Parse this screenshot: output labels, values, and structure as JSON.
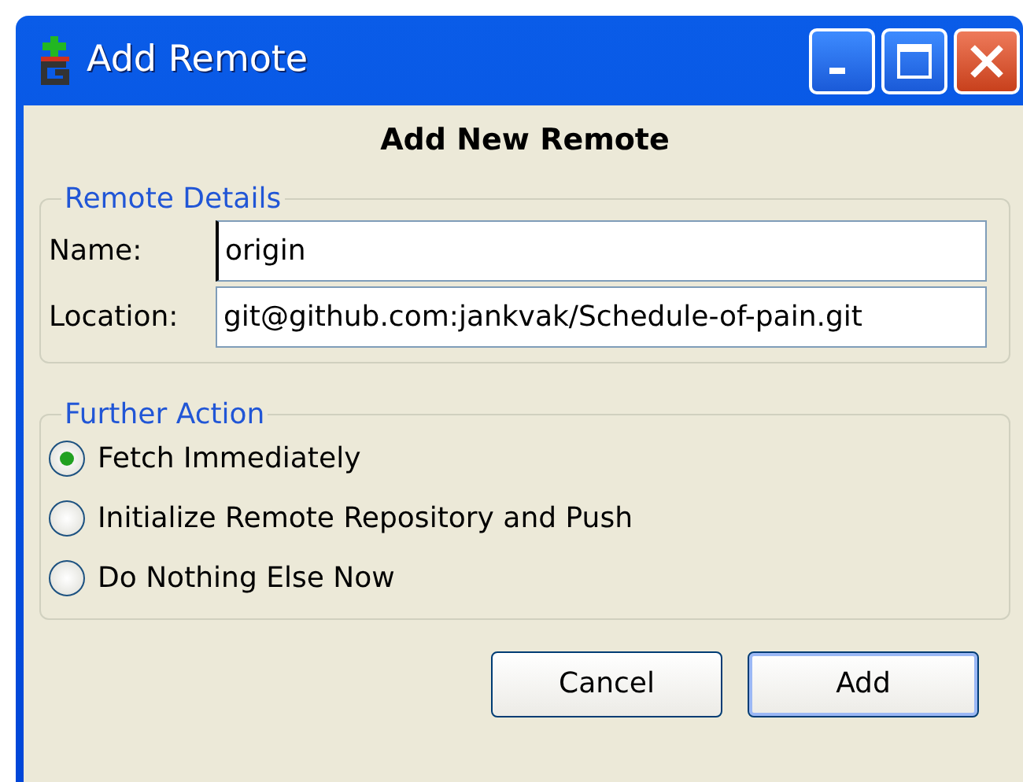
{
  "window": {
    "title": "Add Remote"
  },
  "heading": "Add New Remote",
  "remote_details": {
    "legend": "Remote Details",
    "fields": [
      {
        "label": "Name:",
        "value": "origin"
      },
      {
        "label": "Location:",
        "value": "git@github.com:jankvak/Schedule-of-pain.git"
      }
    ]
  },
  "further_action": {
    "legend": "Further Action",
    "options": [
      {
        "label": "Fetch Immediately",
        "selected": true
      },
      {
        "label": "Initialize Remote Repository and Push",
        "selected": false
      },
      {
        "label": "Do Nothing Else Now",
        "selected": false
      }
    ]
  },
  "buttons": [
    {
      "label": "Cancel",
      "default": false
    },
    {
      "label": "Add",
      "default": true
    }
  ]
}
